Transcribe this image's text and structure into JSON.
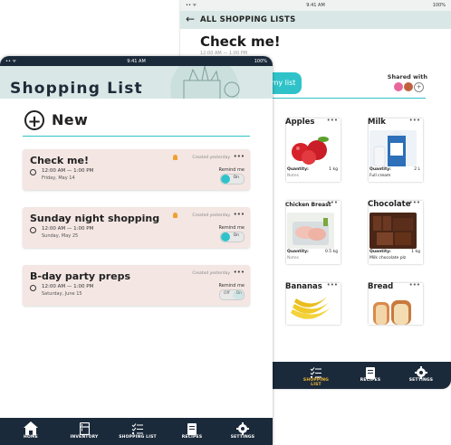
{
  "back_screen": {
    "status": {
      "left": "•• ᯤ",
      "time": "9:41 AM",
      "battery": "100%"
    },
    "header": {
      "back_icon": "arrow-left-icon",
      "title": "ALL SHOPPING LISTS"
    },
    "list_title": "Check me!",
    "list_time": "12:00 AM — 1:00 PM",
    "list_button_label": "my list",
    "shared_with_label": "Shared with",
    "avatar_colors": [
      "#e7679b",
      "#c0613d"
    ],
    "add_avatar_label": "+",
    "more_label": "•••",
    "quantity_label": "Quantity:",
    "items": [
      {
        "name": "Apples",
        "quantity": "1 kg",
        "note": "Notes"
      },
      {
        "name": "Milk",
        "quantity": "2 L",
        "note": "Full cream"
      },
      {
        "name": "Chicken Breast",
        "quantity": "0.5 kg",
        "note": "Notes"
      },
      {
        "name": "Chocolate",
        "quantity": "1 kg",
        "note": "Milk chocolate plz"
      },
      {
        "name": "Bananas"
      },
      {
        "name": "Bread"
      }
    ],
    "nav": [
      {
        "label": "SHOPPING LIST",
        "icon": "checklist-icon",
        "active": true
      },
      {
        "label": "RECIPES",
        "icon": "book-icon",
        "active": false
      },
      {
        "label": "SETTINGS",
        "icon": "gear-icon",
        "active": false
      }
    ]
  },
  "front_screen": {
    "status": {
      "left": "•• ᯤ",
      "time": "9:41 AM",
      "battery": "100%"
    },
    "title": "Shopping List",
    "new_label": "New",
    "more_label": "•••",
    "remind_label": "Remind me",
    "lists": [
      {
        "title": "Check me!",
        "time": "12:00 AM — 1:00 PM",
        "date": "Friday, May 14",
        "created": "Created yesterday",
        "bell": true,
        "toggle": "On"
      },
      {
        "title": "Sunday night shopping",
        "time": "12:00 AM — 1:00 PM",
        "date": "Sunday, May 25",
        "created": "Created yesterday",
        "bell": true,
        "toggle": "On"
      },
      {
        "title": "B-day party preps",
        "time": "12:00 AM — 1:00 PM",
        "date": "Saturday, June 15",
        "created": "Created yesterday",
        "bell": false,
        "toggle_off": "Off",
        "toggle_on": "On"
      }
    ],
    "nav": [
      {
        "label": "HOME",
        "icon": "home-icon"
      },
      {
        "label": "INVENTORY",
        "icon": "fridge-icon"
      },
      {
        "label": "SHOPPING LIST",
        "icon": "checklist-icon"
      },
      {
        "label": "RECIPES",
        "icon": "book-icon"
      },
      {
        "label": "SETTINGS",
        "icon": "gear-icon"
      }
    ]
  },
  "colors": {
    "accent": "#2fc3c9",
    "nav": "#1b2a3a",
    "header": "#d9e8e6",
    "card": "#f3e6e3",
    "active_nav": "#f2b834"
  }
}
